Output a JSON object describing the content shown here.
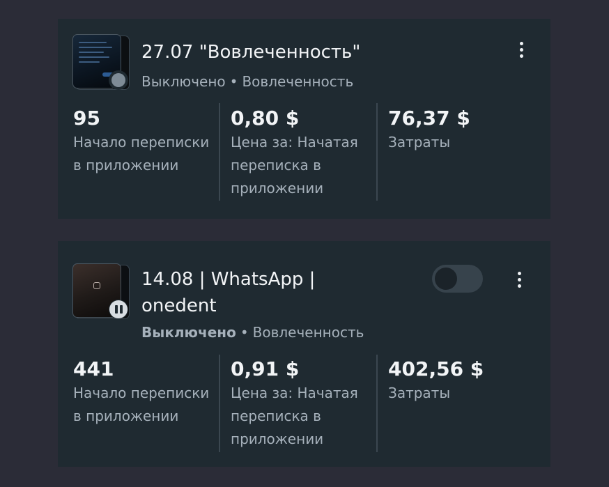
{
  "campaigns": [
    {
      "title": "27.07 \"Вовлеченность\"",
      "status": "Выключено",
      "separator": "•",
      "objective": "Вовлеченность",
      "thumbnail_icon": "ad-preview-image",
      "status_badge_icon": "inactive-dot-icon",
      "metrics": [
        {
          "value": "95",
          "label": "Начало переписки в приложении"
        },
        {
          "value": "0,80 $",
          "label": "Цена за: Начатая переписка в приложении"
        },
        {
          "value": "76,37 $",
          "label": "Затраты"
        }
      ]
    },
    {
      "title_line1": "14.08 | WhatsApp |",
      "title_line2": "onedent",
      "status": "Выключено",
      "separator": "•",
      "objective": "Вовлеченность",
      "thumbnail_icon": "ad-preview-image",
      "status_badge_icon": "pause-icon",
      "toggle_state": "off",
      "metrics": [
        {
          "value": "441",
          "label": "Начало переписки в приложении"
        },
        {
          "value": "0,91 $",
          "label": "Цена за: Начатая переписка в приложении"
        },
        {
          "value": "402,56 $",
          "label": "Затраты"
        }
      ]
    }
  ],
  "colors": {
    "background": "#2b2c37",
    "card": "#1f2a31",
    "text_primary": "#f2f4f6",
    "text_secondary": "#a6b1bb"
  }
}
